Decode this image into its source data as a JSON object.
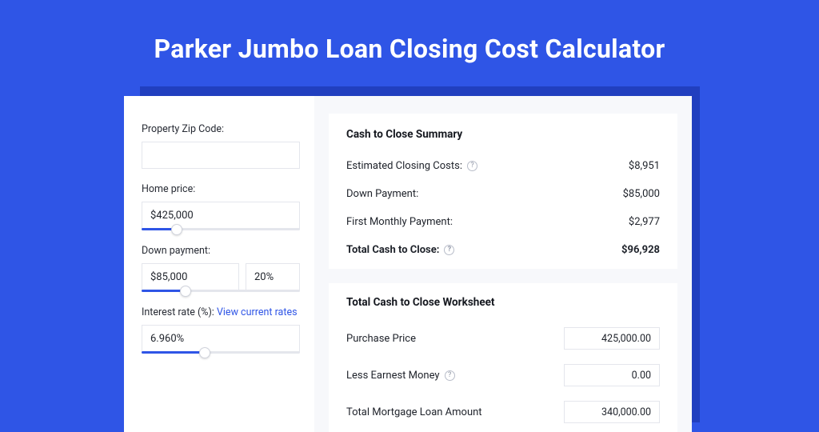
{
  "title": "Parker Jumbo Loan Closing Cost Calculator",
  "left": {
    "zip_label": "Property Zip Code:",
    "zip_value": "",
    "home_price_label": "Home price:",
    "home_price_value": "$425,000",
    "home_price_slider_pct": 22,
    "down_payment_label": "Down payment:",
    "down_payment_value": "$85,000",
    "down_payment_pct_value": "20%",
    "down_payment_slider_pct": 28,
    "interest_label_prefix": "Interest rate (%): ",
    "interest_link": "View current rates",
    "interest_value": "6.960%",
    "interest_slider_pct": 40
  },
  "summary": {
    "title": "Cash to Close Summary",
    "rows": [
      {
        "label": "Estimated Closing Costs:",
        "help": true,
        "value": "$8,951",
        "bold": false
      },
      {
        "label": "Down Payment:",
        "help": false,
        "value": "$85,000",
        "bold": false
      },
      {
        "label": "First Monthly Payment:",
        "help": false,
        "value": "$2,977",
        "bold": false
      },
      {
        "label": "Total Cash to Close:",
        "help": true,
        "value": "$96,928",
        "bold": true
      }
    ]
  },
  "worksheet": {
    "title": "Total Cash to Close Worksheet",
    "rows": [
      {
        "label": "Purchase Price",
        "help": false,
        "value": "425,000.00"
      },
      {
        "label": "Less Earnest Money",
        "help": true,
        "value": "0.00"
      },
      {
        "label": "Total Mortgage Loan Amount",
        "help": false,
        "value": "340,000.00"
      }
    ]
  }
}
